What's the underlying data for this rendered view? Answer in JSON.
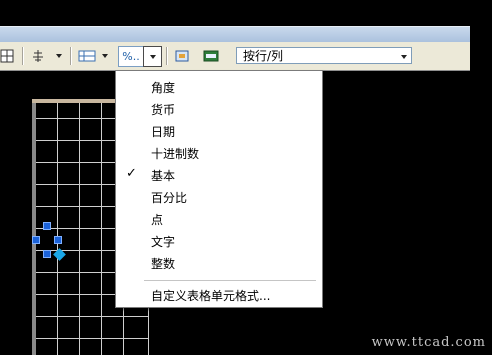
{
  "toolbar": {
    "icons": [
      "table-grid-icon",
      "align-icon",
      "format-icon",
      "percent-icon",
      "insert-block-icon",
      "link-icon"
    ],
    "percent_label": "%..",
    "row_col_select": "按行/列",
    "small_dots": "..."
  },
  "menu": {
    "items": [
      {
        "label": "角度",
        "checked": false
      },
      {
        "label": "货币",
        "checked": false
      },
      {
        "label": "日期",
        "checked": false
      },
      {
        "label": "十进制数",
        "checked": false
      },
      {
        "label": "基本",
        "checked": true
      },
      {
        "label": "百分比",
        "checked": false
      },
      {
        "label": "点",
        "checked": false
      },
      {
        "label": "文字",
        "checked": false
      },
      {
        "label": "整数",
        "checked": false
      }
    ],
    "custom_label": "自定义表格单元格式...",
    "check_mark": "✓"
  },
  "watermark": "www.ttcad.com"
}
